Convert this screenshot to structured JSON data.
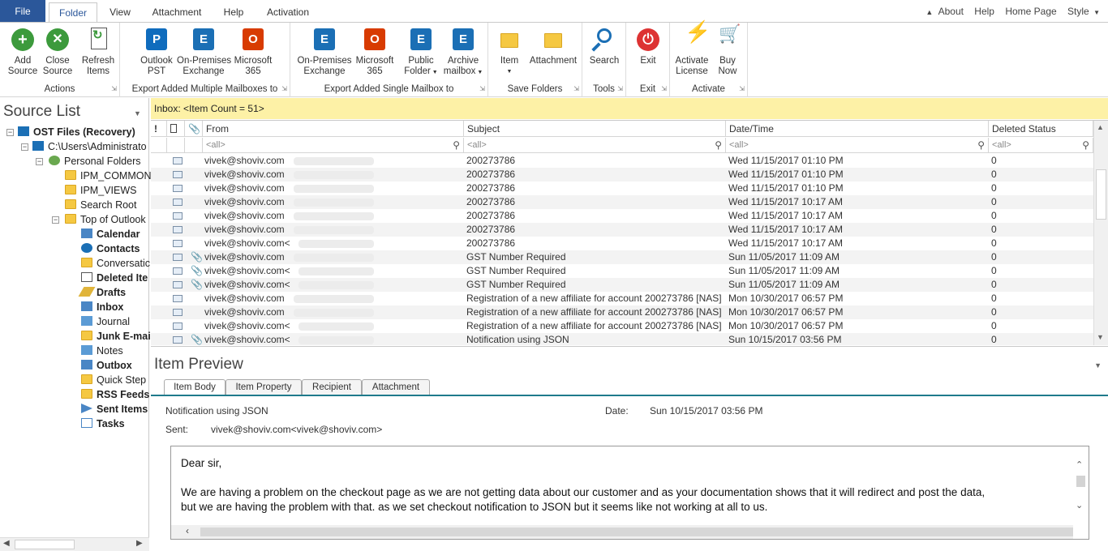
{
  "menu": {
    "tabs": [
      "File",
      "Folder",
      "View",
      "Attachment",
      "Help",
      "Activation"
    ],
    "right": [
      "About",
      "Help",
      "Home Page",
      "Style"
    ]
  },
  "ribbon": {
    "groups": [
      {
        "label": "Actions",
        "buttons": [
          {
            "l1": "Add",
            "l2": "Source",
            "icon": "add-circle-icon",
            "color": "#3c9a3c"
          },
          {
            "l1": "Close",
            "l2": "Source",
            "icon": "close-circle-icon",
            "color": "#3c9a3c"
          },
          {
            "l1": "Refresh",
            "l2": "Items",
            "icon": "refresh-doc-icon",
            "color": "#3c9a3c"
          }
        ]
      },
      {
        "label": "Export Added Multiple Mailboxes to",
        "buttons": [
          {
            "l1": "Outlook",
            "l2": "PST",
            "icon": "outlook-icon",
            "color": "#0f6cbd"
          },
          {
            "l1": "On-Premises",
            "l2": "Exchange",
            "icon": "exchange-icon",
            "color": "#1b6fb5"
          },
          {
            "l1": "Microsoft",
            "l2": "365",
            "icon": "office365-icon",
            "color": "#d83b01"
          }
        ]
      },
      {
        "label": "Export Added Single Mailbox to",
        "buttons": [
          {
            "l1": "On-Premises",
            "l2": "Exchange",
            "icon": "exchange-icon",
            "color": "#1b6fb5"
          },
          {
            "l1": "Microsoft",
            "l2": "365",
            "icon": "office365-icon",
            "color": "#d83b01"
          },
          {
            "l1": "Public",
            "l2": "Folder",
            "icon": "public-folder-icon",
            "color": "#1b6fb5"
          },
          {
            "l1": "Archive",
            "l2": "mailbox",
            "icon": "archive-mailbox-icon",
            "color": "#1b6fb5"
          }
        ]
      },
      {
        "label": "Save Folders",
        "buttons": [
          {
            "l1": "Item",
            "l2": "",
            "icon": "item-save-icon",
            "color": "#d9a520"
          },
          {
            "l1": "Attachment",
            "l2": "",
            "icon": "attachment-save-icon",
            "color": "#d9a520"
          }
        ]
      },
      {
        "label": "Tools",
        "buttons": [
          {
            "l1": "Search",
            "l2": "",
            "icon": "search-icon",
            "color": "#1b6fb5"
          }
        ]
      },
      {
        "label": "Exit",
        "buttons": [
          {
            "l1": "Exit",
            "l2": "",
            "icon": "power-icon",
            "color": "#d33"
          }
        ]
      },
      {
        "label": "Activate",
        "buttons": [
          {
            "l1": "Activate",
            "l2": "License",
            "icon": "lightning-icon",
            "color": "#3c9a3c"
          },
          {
            "l1": "Buy",
            "l2": "Now",
            "icon": "cart-icon",
            "color": "#3c9a3c"
          }
        ]
      }
    ]
  },
  "source_list": {
    "title": "Source List",
    "tree": [
      {
        "label": "OST Files (Recovery)",
        "bold": true
      },
      {
        "label": "C:\\Users\\Administrato",
        "bold": false
      },
      {
        "label": "Personal Folders",
        "bold": false
      },
      {
        "label": "IPM_COMMON",
        "bold": false
      },
      {
        "label": "IPM_VIEWS",
        "bold": false
      },
      {
        "label": "Search Root",
        "bold": false
      },
      {
        "label": "Top of Outlook",
        "bold": false
      },
      {
        "label": "Calendar",
        "bold": true
      },
      {
        "label": "Contacts",
        "bold": true
      },
      {
        "label": "Conversatic",
        "bold": false
      },
      {
        "label": "Deleted Ite",
        "bold": true
      },
      {
        "label": "Drafts",
        "bold": true
      },
      {
        "label": "Inbox",
        "bold": true
      },
      {
        "label": "Journal",
        "bold": false
      },
      {
        "label": "Junk E-mai",
        "bold": true
      },
      {
        "label": "Notes",
        "bold": false
      },
      {
        "label": "Outbox",
        "bold": true
      },
      {
        "label": "Quick Step",
        "bold": false
      },
      {
        "label": "RSS Feeds",
        "bold": true
      },
      {
        "label": "Sent Items",
        "bold": true
      },
      {
        "label": "Tasks",
        "bold": true
      }
    ]
  },
  "inbox_bar": "Inbox: <Item Count = 51>",
  "grid": {
    "headers": [
      "!",
      "",
      "",
      "From",
      "Subject",
      "Date/Time",
      "Deleted Status"
    ],
    "filter": "<all>",
    "rows": [
      {
        "from": "vivek@shoviv.com",
        "subject": "200273786",
        "date": "Wed 11/15/2017 01:10 PM",
        "status": "0",
        "attach": false
      },
      {
        "from": "vivek@shoviv.com",
        "subject": "200273786",
        "date": "Wed 11/15/2017 01:10 PM",
        "status": "0",
        "attach": false
      },
      {
        "from": "vivek@shoviv.com",
        "subject": "200273786",
        "date": "Wed 11/15/2017 01:10 PM",
        "status": "0",
        "attach": false
      },
      {
        "from": "vivek@shoviv.com",
        "subject": "200273786",
        "date": "Wed 11/15/2017 10:17 AM",
        "status": "0",
        "attach": false
      },
      {
        "from": "vivek@shoviv.com",
        "subject": "200273786",
        "date": "Wed 11/15/2017 10:17 AM",
        "status": "0",
        "attach": false
      },
      {
        "from": "vivek@shoviv.com",
        "subject": "200273786",
        "date": "Wed 11/15/2017 10:17 AM",
        "status": "0",
        "attach": false
      },
      {
        "from": "vivek@shoviv.com<",
        "subject": "200273786",
        "date": "Wed 11/15/2017 10:17 AM",
        "status": "0",
        "attach": false
      },
      {
        "from": "vivek@shoviv.com",
        "subject": "GST Number Required",
        "date": "Sun 11/05/2017 11:09 AM",
        "status": "0",
        "attach": true
      },
      {
        "from": "vivek@shoviv.com<",
        "subject": "GST Number Required",
        "date": "Sun 11/05/2017 11:09 AM",
        "status": "0",
        "attach": true
      },
      {
        "from": "vivek@shoviv.com<",
        "subject": "GST Number Required",
        "date": "Sun 11/05/2017 11:09 AM",
        "status": "0",
        "attach": true
      },
      {
        "from": "vivek@shoviv.com",
        "subject": "Registration of a new affiliate for account 200273786 [NAS]",
        "date": "Mon 10/30/2017 06:57 PM",
        "status": "0",
        "attach": false
      },
      {
        "from": "vivek@shoviv.com",
        "subject": "Registration of a new affiliate for account 200273786 [NAS]",
        "date": "Mon 10/30/2017 06:57 PM",
        "status": "0",
        "attach": false
      },
      {
        "from": "vivek@shoviv.com<",
        "subject": "Registration of a new affiliate for account 200273786 [NAS]",
        "date": "Mon 10/30/2017 06:57 PM",
        "status": "0",
        "attach": false
      },
      {
        "from": "vivek@shoviv.com<",
        "subject": "Notification using JSON",
        "date": "Sun 10/15/2017 03:56 PM",
        "status": "0",
        "attach": true
      }
    ]
  },
  "preview": {
    "title": "Item Preview",
    "tabs": [
      "Item Body",
      "Item Property",
      "Recipient",
      "Attachment"
    ],
    "subject": "Notification using JSON",
    "date_label": "Date:",
    "date_value": "Sun 10/15/2017 03:56 PM",
    "sent_label": "Sent:",
    "sent_value": "vivek@shoviv.com<vivek@shoviv.com>",
    "body": [
      "Dear sir,",
      "We are having a problem on the checkout page as we are not getting data about our customer and as your documentation shows that it will redirect and post the data,",
      "but we are having the problem with that. as we set checkout notification to JSON but it seems like not working at all to us."
    ]
  }
}
